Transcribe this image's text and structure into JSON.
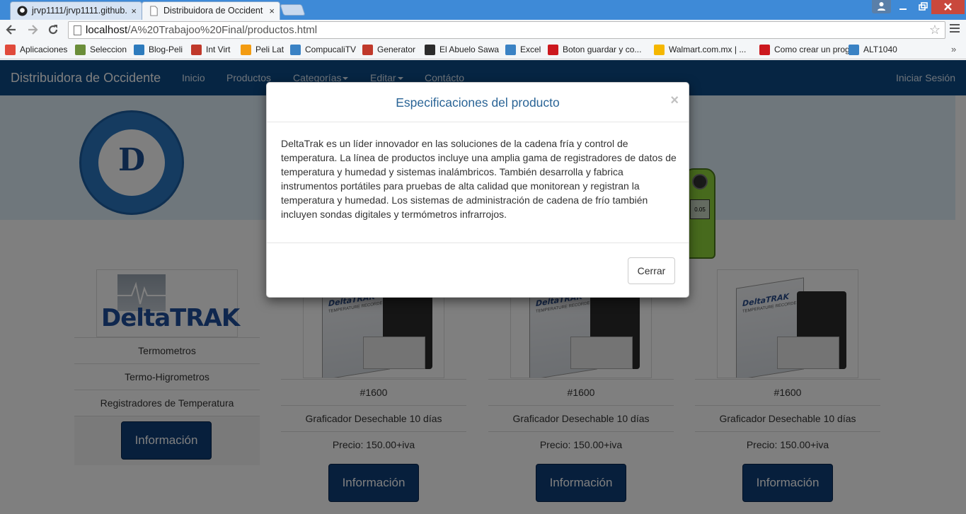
{
  "browser": {
    "tabs": [
      {
        "title": "jrvp1111/jrvp1111.github.",
        "active": false
      },
      {
        "title": "Distribuidora de Occident",
        "active": true
      }
    ],
    "tab_close": "×",
    "url_host": "localhost",
    "url_path": "/A%20Trabajoo%20Final/productos.html"
  },
  "bookmarks": [
    {
      "label": "Aplicaciones",
      "icon": "apps-grid-icon",
      "color": "#e04a3b"
    },
    {
      "label": "Seleccion",
      "icon": "soccer-icon",
      "color": "#6b8e3a"
    },
    {
      "label": "Blog-Peli",
      "icon": "blog-icon",
      "color": "#2d7bbd"
    },
    {
      "label": "Int Virt",
      "icon": "tv-icon",
      "color": "#c0392b"
    },
    {
      "label": "Peli Lat",
      "icon": "blogger-icon",
      "color": "#f39c12"
    },
    {
      "label": "CompucaliTV",
      "icon": "tv-box-icon",
      "color": "#3a82c4"
    },
    {
      "label": "Generator",
      "icon": "generator-icon",
      "color": "#c0392b"
    },
    {
      "label": "El Abuelo Sawa",
      "icon": "image-icon",
      "color": "#2c2c2c"
    },
    {
      "label": "Excel",
      "icon": "tv-box-icon",
      "color": "#3a82c4"
    },
    {
      "label": "Boton guardar y co...",
      "icon": "youtube-icon",
      "color": "#cc181e"
    },
    {
      "label": "Walmart.com.mx | ...",
      "icon": "walmart-icon",
      "color": "#f5b700"
    },
    {
      "label": "Como crear un prog...",
      "icon": "youtube-icon",
      "color": "#cc181e"
    },
    {
      "label": "ALT1040",
      "icon": "tv-box-icon",
      "color": "#3a82c4"
    }
  ],
  "bookmarks_more": "»",
  "site": {
    "brand": "Distribuidora de Occidente",
    "nav": [
      "Inicio",
      "Productos",
      "Categorías",
      "Editar",
      "Contácto"
    ],
    "login": "Iniciar Sesión",
    "brand_color": "#0c4a87"
  },
  "logo": {
    "letter": "D",
    "device_reading": "0.05"
  },
  "sidebar": {
    "brand_wordmark": "DeltaTRAK",
    "items": [
      "Termometros",
      "Termo-Higrometros",
      "Registradores de Temperatura"
    ],
    "button": "Información"
  },
  "products": [
    {
      "code": "#1600",
      "name": "Graficador Desechable 10 días",
      "price": "Precio: 150.00+iva",
      "button": "Información",
      "box_brand": "DeltaTRAK",
      "box_text": "TEMPERATURE RECORDER"
    },
    {
      "code": "#1600",
      "name": "Graficador Desechable 10 días",
      "price": "Precio: 150.00+iva",
      "button": "Información",
      "box_brand": "DeltaTRAK",
      "box_text": "TEMPERATURE RECORDER"
    },
    {
      "code": "#1600",
      "name": "Graficador Desechable 10 días",
      "price": "Precio: 150.00+iva",
      "button": "Información",
      "box_brand": "DeltaTRAK",
      "box_text": "TEMPERATURE RECORDER"
    }
  ],
  "modal": {
    "title": "Especificaciones del producto",
    "close_x": "×",
    "body": "DeltaTrak es un líder innovador en las soluciones de la cadena fría y control de temperatura. La línea de productos incluye una amplia gama de registradores de datos de temperatura y humedad y sistemas inalámbricos. También desarrolla y fabrica instrumentos portátiles para pruebas de alta calidad que monitorean y registran la temperatura y humedad. Los sistemas de administración de cadena de frío también incluyen sondas digitales y termómetros infrarrojos.",
    "close_button": "Cerrar"
  }
}
